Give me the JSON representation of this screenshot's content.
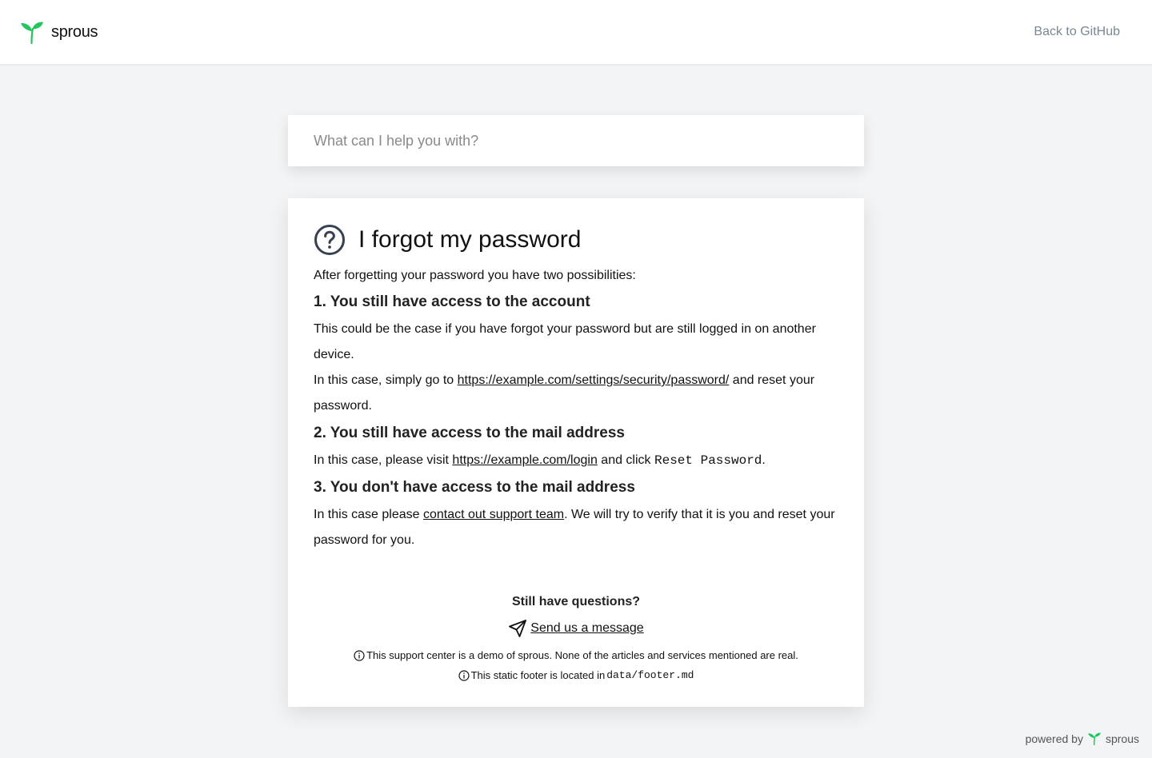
{
  "header": {
    "brand_name": "sprous",
    "back_link": "Back to GitHub",
    "brand_color": "#22c55e"
  },
  "search": {
    "placeholder": "What can I help you with?",
    "value": ""
  },
  "article": {
    "icon": "question-circle-icon",
    "title": "I forgot my password",
    "intro": "After forgetting your password you have two possibilities:",
    "sections": [
      {
        "heading": "1. You still have access to the account",
        "p1": "This could be the case if you have forgot your password but are still logged in on another device.",
        "p2_before": "In this case, simply go to ",
        "p2_link": "https://example.com/settings/security/password/",
        "p2_after": " and reset your password."
      },
      {
        "heading": "2. You still have access to the mail address",
        "p_before": "In this case, please visit ",
        "p_link": "https://example.com/login",
        "p_middle": " and click ",
        "p_code": "Reset Password",
        "p_after": "."
      },
      {
        "heading": "3. You don't have access to the mail address",
        "p_before": "In this case please ",
        "p_link": "contact out support team",
        "p_after": ". We will try to verify that it is you and reset your password for you."
      }
    ]
  },
  "footer": {
    "question": "Still have questions?",
    "send_icon": "paper-plane-icon",
    "send_label": "Send us a message",
    "note1": "This support center is a demo of sprous. None of the articles and services mentioned are real.",
    "note2_text": "This static footer is located in ",
    "note2_code": "data/footer.md",
    "info_icon": "info-circle-icon"
  },
  "powered": {
    "label": "powered by",
    "brand": "sprous"
  }
}
